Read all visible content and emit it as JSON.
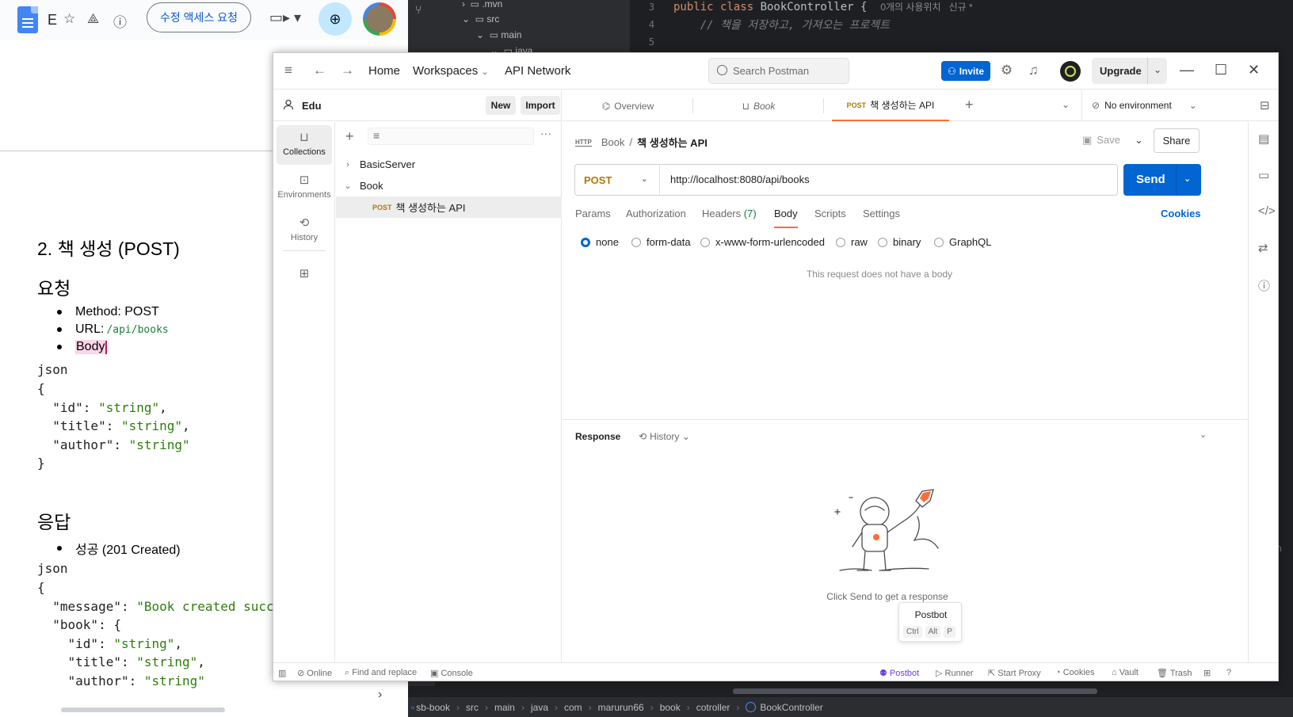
{
  "gdocs": {
    "title_initial": "E",
    "access_button": "수정 액세스 요청",
    "heading_section": "2. 책 생성 (POST)",
    "heading_request": "요청",
    "req_items": [
      "Method: POST",
      "URL: ",
      "Body"
    ],
    "req_url_code": "/api/books",
    "json_label_1": "json",
    "request_json": [
      "{",
      "  \"id\": ",
      "\"string\"",
      ",",
      "  \"title\": ",
      "\"string\"",
      ",",
      "  \"author\": ",
      "\"string\"",
      "}"
    ],
    "heading_response": "응답",
    "resp_item": "성공 (201 Created)",
    "json_label_2": "json",
    "resp_message_key": "  \"message\": ",
    "resp_message_val": "\"Book created succ",
    "resp_book_key": "  \"book\": {",
    "resp_id_key": "    \"id\": ",
    "resp_title_key": "    \"title\": ",
    "resp_author_key": "    \"author\": ",
    "string_val": "\"string\""
  },
  "ide": {
    "tree": [
      ".mvn",
      "src",
      "main",
      "java"
    ],
    "lines": [
      "3",
      "4",
      "5"
    ],
    "code_kw1": "public class ",
    "code_cls": "BookController",
    "code_brace": " {",
    "code_hint": "0개의 사용위치   신규 *",
    "code_comment": "// 책을 저장하고, 가져오는 프로젝트",
    "breadcrumb": [
      "sb-book",
      "src",
      "main",
      "java",
      "com",
      "marurun66",
      "book",
      "cotroller",
      "BookController"
    ]
  },
  "postman": {
    "nav": {
      "home": "Home",
      "workspaces": "Workspaces",
      "api_network": "API Network"
    },
    "search_placeholder": "Search Postman",
    "invite": "Invite",
    "upgrade": "Upgrade",
    "workspace_name": "Edu",
    "new_button": "New",
    "import_button": "Import",
    "rail": [
      "Collections",
      "Environments",
      "History"
    ],
    "collections": [
      {
        "name": "BasicServer",
        "expanded": false
      },
      {
        "name": "Book",
        "expanded": true
      }
    ],
    "request_item": {
      "method": "POST",
      "name": "책 생성하는 API"
    },
    "tabs": [
      {
        "label": "Overview"
      },
      {
        "label": "Book"
      },
      {
        "method": "POST",
        "label": "책 생성하는 API"
      }
    ],
    "environment": "No environment",
    "breadcrumb": {
      "parent": "Book",
      "sep": "/",
      "current": "책 생성하는 API",
      "badge": "HTTP"
    },
    "save": "Save",
    "share": "Share",
    "method": "POST",
    "url": "http://localhost:8080/api/books",
    "send": "Send",
    "subtabs": [
      "Params",
      "Authorization",
      "Headers",
      "Body",
      "Scripts",
      "Settings"
    ],
    "headers_count": "(7)",
    "cookies": "Cookies",
    "body_types": [
      "none",
      "form-data",
      "x-www-form-urlencoded",
      "raw",
      "binary",
      "GraphQL"
    ],
    "body_selected": "none",
    "no_body_text": "This request does not have a body",
    "response_label": "Response",
    "response_history": "History",
    "response_hint": "Click Send to get a response",
    "postbot": {
      "title": "Postbot",
      "keys": [
        "Ctrl",
        "Alt",
        "P"
      ]
    },
    "footer": {
      "online": "Online",
      "find_replace": "Find and replace",
      "console": "Console",
      "postbot": "Postbot",
      "runner": "Runner",
      "start_proxy": "Start Proxy",
      "cookies": "Cookies",
      "vault": "Vault",
      "trash": "Trash"
    },
    "colors": {
      "brand_orange": "#ff6c37",
      "send_blue": "#0265d2",
      "post_method": "#ad7a03"
    }
  }
}
